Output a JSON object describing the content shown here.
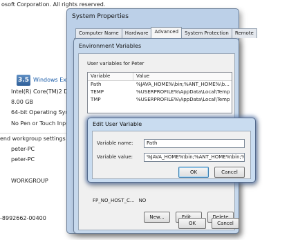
{
  "background": {
    "copyright": "osoft Corporation.  All rights reserved.",
    "score": "3.5",
    "score_link": "Windows Experi",
    "processor": "Intel(R) Core(TM)2 Duc",
    "memory": "8.00 GB",
    "system_type": "64-bit Operating Syste",
    "pen_touch": "No Pen or Touch Input",
    "section_heading": "end workgroup settings",
    "computer_name": "peter-PC",
    "full_name": "peter-PC",
    "workgroup": "WORKGROUP",
    "product_id": "-8992662-00400"
  },
  "system_properties": {
    "title": "System Properties",
    "tabs": [
      "Computer Name",
      "Hardware",
      "Advanced",
      "System Protection",
      "Remote"
    ],
    "active_tab": "Advanced"
  },
  "environment_variables": {
    "title": "Environment Variables",
    "user_group_label": "User variables for Peter",
    "columns": [
      "Variable",
      "Value"
    ],
    "rows": [
      {
        "variable": "Path",
        "value": "%JAVA_HOME%\\bin;%ANT_HOME%\\b..."
      },
      {
        "variable": "TEMP",
        "value": "%USERPROFILE%\\AppData\\Local\\Temp"
      },
      {
        "variable": "TMP",
        "value": "%USERPROFILE%\\AppData\\Local\\Temp"
      }
    ],
    "system_row": {
      "variable": "FP_NO_HOST_C...",
      "value": "NO"
    },
    "buttons": {
      "new": "New...",
      "edit": "Edit...",
      "delete": "Delete",
      "ok": "OK",
      "cancel": "Cancel"
    }
  },
  "edit_user_variable": {
    "title": "Edit User Variable",
    "name_label": "Variable name:",
    "name_value": "Path",
    "value_label": "Variable value:",
    "value_value": "%JAVA_HOME%\\bin;%ANT_HOME%\\bin;%",
    "ok": "OK",
    "cancel": "Cancel"
  }
}
